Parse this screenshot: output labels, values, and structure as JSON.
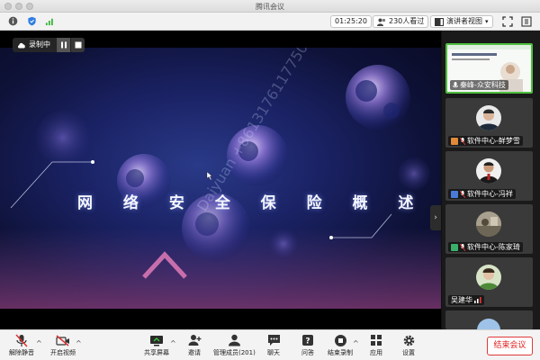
{
  "window": {
    "title": "腾讯会议"
  },
  "toolbar": {
    "timer": "01:25:20",
    "viewers": "230人看过",
    "view_mode": "演讲者视图"
  },
  "recording": {
    "label": "录制中"
  },
  "slide": {
    "title": "网 络 安 全 保 险 概 述",
    "watermark": "Daiyuan +8613176117750"
  },
  "participants": [
    {
      "name": "秦峰-众安科技",
      "active": true
    },
    {
      "name": "软件中心-鲜梦雪",
      "active": false
    },
    {
      "name": "软件中心-冯祥",
      "active": false
    },
    {
      "name": "软件中心-陈家琦",
      "active": false
    },
    {
      "name": "吴建华",
      "active": false
    }
  ],
  "bottom": {
    "unmute": "解除静音",
    "start_video": "开启视频",
    "share_screen": "共享屏幕",
    "invite": "邀请",
    "manage_members": "管理成员(201)",
    "chat": "聊天",
    "qa": "问答",
    "end_recording": "结束录制",
    "apps": "应用",
    "settings": "设置",
    "end_meeting": "结束会议"
  },
  "colors": {
    "accent_green": "#4fbf3f",
    "end_red": "#e02020",
    "slide_bg": "#1a2264"
  }
}
